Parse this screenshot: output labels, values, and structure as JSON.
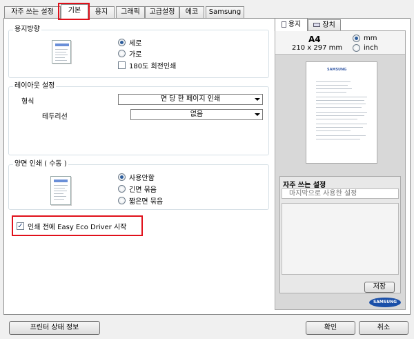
{
  "tabs": [
    {
      "label": "자주 쓰는 설정"
    },
    {
      "label": "기본"
    },
    {
      "label": "용지"
    },
    {
      "label": "그래픽"
    },
    {
      "label": "고급설정"
    },
    {
      "label": "에코"
    },
    {
      "label": "Samsung"
    }
  ],
  "orientation": {
    "title": "용지방향",
    "options": [
      "세로",
      "가로"
    ],
    "selected": "세로",
    "rotate_label": "180도 회전인쇄",
    "rotate_checked": false
  },
  "layout": {
    "title": "레이아웃 설정",
    "type_label": "형식",
    "type_value": "면 당 한 페이지 인쇄",
    "border_label": "테두리선",
    "border_value": "없음"
  },
  "duplex": {
    "title": "양면 인쇄 ( 수동 )",
    "options": [
      "사용안함",
      "긴면 묶음",
      "짧은면 묶음"
    ],
    "selected": "사용안함"
  },
  "eco": {
    "label": "인쇄 전에 Easy Eco Driver 시작",
    "checked": true
  },
  "preview": {
    "tabs": [
      "용지",
      "장치"
    ],
    "paper_size": "A4",
    "paper_dims": "210 x 297 mm",
    "units": [
      "mm",
      "inch"
    ],
    "selected_unit": "mm",
    "paper_logo": "SAMSUNG"
  },
  "favorites": {
    "title": "자주 쓰는 설정",
    "placeholder": "마지막으로 사용한 설정",
    "save_label": "저장"
  },
  "brand": "SAMSUNG",
  "buttons": {
    "status_label": "프린터 상태 정보",
    "ok_label": "확인",
    "cancel_label": "취소"
  },
  "colors": {
    "highlight": "#e0101a",
    "brand_blue": "#1a4fa8"
  }
}
